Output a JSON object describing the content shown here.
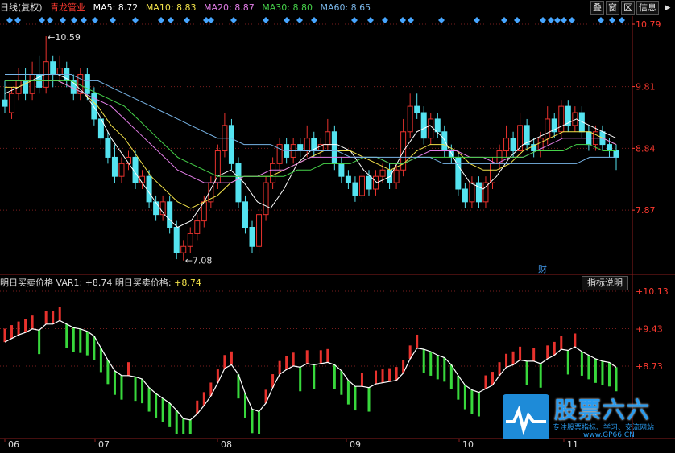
{
  "header": {
    "chart_label": "日线(复权)",
    "stock_name": "青龙管业",
    "ma5": "MA5: 8.72",
    "ma10": "MA10: 8.83",
    "ma20": "MA20: 8.87",
    "ma30": "MA30: 8.80",
    "ma60": "MA60: 8.65",
    "btn_stack": "叠",
    "btn_window": "窗",
    "btn_area": "区",
    "btn_info": "信息",
    "btn_menu": "▶"
  },
  "colors": {
    "up": "#e8322d",
    "down": "#54e3f0",
    "ma5": "#ffffff",
    "ma10": "#f2e24a",
    "ma20": "#e37ee8",
    "ma30": "#46d24a",
    "ma60": "#78b4e6",
    "grid": "#7a1e1e",
    "marker": "#47a6ff",
    "sub_up": "#e8322d",
    "sub_down": "#38d83c"
  },
  "sub": {
    "label1": "明日买卖价格",
    "var1": "VAR1: +8.74",
    "label2": "明日买卖价格:",
    "val2": "+8.74",
    "btn": "指标说明"
  },
  "annotations": {
    "high": "←10.59",
    "low": "←7.08",
    "fin": "财"
  },
  "logo": {
    "title": "股票六六",
    "subtitle": "专注股票指标、学习、交流网站",
    "url": "www.GP66.CN"
  },
  "chart_data": {
    "type": "candlestick",
    "price_axis": {
      "ticks": [
        "10.79",
        "9.81",
        "8.84",
        "7.87"
      ],
      "range": [
        7.0,
        10.79
      ]
    },
    "sub_axis": {
      "ticks": [
        "+10.13",
        "+9.43",
        "+8.73"
      ],
      "range": [
        7.45,
        10.13
      ]
    },
    "x_labels": [
      "06",
      "07",
      "08",
      "09",
      "10",
      "11"
    ],
    "candles": [
      [
        9.6,
        9.5,
        9.9,
        9.4
      ],
      [
        9.4,
        9.7,
        9.8,
        9.3
      ],
      [
        9.7,
        9.9,
        10.1,
        9.6
      ],
      [
        9.9,
        9.7,
        10.1,
        9.6
      ],
      [
        9.7,
        10.0,
        10.2,
        9.6
      ],
      [
        10.0,
        9.8,
        10.3,
        9.7
      ],
      [
        9.8,
        10.2,
        10.6,
        9.7
      ],
      [
        10.2,
        10.0,
        10.3,
        9.8
      ],
      [
        10.0,
        10.1,
        10.3,
        9.9
      ],
      [
        10.1,
        9.9,
        10.2,
        9.8
      ],
      [
        9.9,
        9.7,
        10.0,
        9.6
      ],
      [
        9.7,
        10.0,
        10.1,
        9.6
      ],
      [
        10.0,
        9.7,
        10.1,
        9.6
      ],
      [
        9.7,
        9.3,
        9.8,
        9.2
      ],
      [
        9.3,
        9.0,
        9.4,
        8.9
      ],
      [
        9.0,
        8.7,
        9.1,
        8.6
      ],
      [
        8.7,
        8.4,
        8.9,
        8.3
      ],
      [
        8.4,
        8.6,
        8.7,
        8.3
      ],
      [
        8.6,
        8.7,
        8.8,
        8.5
      ],
      [
        8.7,
        8.3,
        8.8,
        8.2
      ],
      [
        8.3,
        8.4,
        8.5,
        8.2
      ],
      [
        8.4,
        8.0,
        8.5,
        7.9
      ],
      [
        8.0,
        7.8,
        8.1,
        7.7
      ],
      [
        7.8,
        8.0,
        8.1,
        7.7
      ],
      [
        8.0,
        7.6,
        8.1,
        7.5
      ],
      [
        7.6,
        7.2,
        7.7,
        7.1
      ],
      [
        7.2,
        7.3,
        7.4,
        7.08
      ],
      [
        7.3,
        7.5,
        7.6,
        7.2
      ],
      [
        7.5,
        7.7,
        7.8,
        7.4
      ],
      [
        7.7,
        8.0,
        8.1,
        7.6
      ],
      [
        8.0,
        8.3,
        8.4,
        7.9
      ],
      [
        8.3,
        8.8,
        8.9,
        8.2
      ],
      [
        8.8,
        9.2,
        9.4,
        8.7
      ],
      [
        9.2,
        8.6,
        9.3,
        8.5
      ],
      [
        8.6,
        8.0,
        8.7,
        7.9
      ],
      [
        8.0,
        7.6,
        8.1,
        7.5
      ],
      [
        7.6,
        7.3,
        7.7,
        7.2
      ],
      [
        7.3,
        7.8,
        7.9,
        7.2
      ],
      [
        7.8,
        8.3,
        8.4,
        7.7
      ],
      [
        8.3,
        8.6,
        8.7,
        8.2
      ],
      [
        8.6,
        8.9,
        9.0,
        8.5
      ],
      [
        8.9,
        8.7,
        9.0,
        8.6
      ],
      [
        8.7,
        8.9,
        9.0,
        8.6
      ],
      [
        8.9,
        8.8,
        9.0,
        8.7
      ],
      [
        8.8,
        9.0,
        9.2,
        8.7
      ],
      [
        9.0,
        8.8,
        9.1,
        8.7
      ],
      [
        8.8,
        8.9,
        9.0,
        8.7
      ],
      [
        8.9,
        9.1,
        9.3,
        8.8
      ],
      [
        9.1,
        8.6,
        9.2,
        8.5
      ],
      [
        8.6,
        8.4,
        8.7,
        8.3
      ],
      [
        8.4,
        8.3,
        8.5,
        8.2
      ],
      [
        8.3,
        8.1,
        8.4,
        8.0
      ],
      [
        8.1,
        8.4,
        8.5,
        8.0
      ],
      [
        8.4,
        8.2,
        8.5,
        8.1
      ],
      [
        8.2,
        8.4,
        8.5,
        8.1
      ],
      [
        8.4,
        8.5,
        8.6,
        8.3
      ],
      [
        8.5,
        8.3,
        8.6,
        8.2
      ],
      [
        8.3,
        8.5,
        8.6,
        8.2
      ],
      [
        8.5,
        9.1,
        9.3,
        8.4
      ],
      [
        9.1,
        9.5,
        9.7,
        9.0
      ],
      [
        9.5,
        9.4,
        9.7,
        9.3
      ],
      [
        9.4,
        9.0,
        9.5,
        8.9
      ],
      [
        9.0,
        9.3,
        9.4,
        8.9
      ],
      [
        9.3,
        9.1,
        9.4,
        9.0
      ],
      [
        9.1,
        8.8,
        9.2,
        8.7
      ],
      [
        8.8,
        8.7,
        8.9,
        8.6
      ],
      [
        8.7,
        8.2,
        8.8,
        8.1
      ],
      [
        8.2,
        8.0,
        8.3,
        7.9
      ],
      [
        8.0,
        8.3,
        8.4,
        7.9
      ],
      [
        8.3,
        8.0,
        8.4,
        7.9
      ],
      [
        8.0,
        8.3,
        8.4,
        7.9
      ],
      [
        8.3,
        8.6,
        8.7,
        8.2
      ],
      [
        8.6,
        8.8,
        8.9,
        8.5
      ],
      [
        8.8,
        9.0,
        9.2,
        8.7
      ],
      [
        9.0,
        8.8,
        9.1,
        8.7
      ],
      [
        8.8,
        9.2,
        9.4,
        8.7
      ],
      [
        9.2,
        8.9,
        9.3,
        8.8
      ],
      [
        8.9,
        8.8,
        9.0,
        8.7
      ],
      [
        8.8,
        9.0,
        9.1,
        8.7
      ],
      [
        9.0,
        9.3,
        9.5,
        8.9
      ],
      [
        9.3,
        9.1,
        9.4,
        9.0
      ],
      [
        9.1,
        9.5,
        9.6,
        9.0
      ],
      [
        9.5,
        9.2,
        9.6,
        9.1
      ],
      [
        9.2,
        9.4,
        9.5,
        9.1
      ],
      [
        9.4,
        9.1,
        9.5,
        9.0
      ],
      [
        9.1,
        8.9,
        9.2,
        8.8
      ],
      [
        8.9,
        9.1,
        9.2,
        8.8
      ],
      [
        9.1,
        8.9,
        9.2,
        8.8
      ],
      [
        8.9,
        8.8,
        9.0,
        8.7
      ],
      [
        8.8,
        8.7,
        8.9,
        8.5
      ]
    ],
    "ma_lines": {
      "ma5": [
        9.7,
        9.8,
        9.9,
        10.0,
        10.0,
        9.9,
        9.7,
        9.4,
        9.0,
        8.7,
        8.4,
        8.1,
        7.8,
        7.6,
        7.7,
        8.0,
        8.4,
        8.5,
        8.3,
        8.0,
        7.9,
        8.2,
        8.6,
        8.8,
        8.9,
        8.9,
        8.8,
        8.5,
        8.3,
        8.4,
        8.8,
        9.1,
        9.2,
        9.0,
        8.6,
        8.3,
        8.2,
        8.4,
        8.7,
        8.9,
        9.0,
        9.1,
        9.2,
        9.3,
        9.2,
        9.1,
        9.0
      ],
      "ma10": [
        9.8,
        9.8,
        9.9,
        9.9,
        9.9,
        9.8,
        9.7,
        9.5,
        9.2,
        9.0,
        8.7,
        8.4,
        8.2,
        8.0,
        7.9,
        8.0,
        8.1,
        8.3,
        8.4,
        8.4,
        8.4,
        8.5,
        8.6,
        8.7,
        8.8,
        8.8,
        8.8,
        8.7,
        8.6,
        8.5,
        8.6,
        8.8,
        8.9,
        8.9,
        8.8,
        8.6,
        8.5,
        8.5,
        8.6,
        8.8,
        8.9,
        9.0,
        9.1,
        9.1,
        9.1,
        9.0,
        8.9
      ],
      "ma20": [
        9.9,
        9.9,
        9.9,
        9.9,
        9.9,
        9.8,
        9.7,
        9.6,
        9.5,
        9.3,
        9.1,
        8.9,
        8.7,
        8.5,
        8.4,
        8.3,
        8.3,
        8.3,
        8.4,
        8.4,
        8.5,
        8.5,
        8.6,
        8.7,
        8.7,
        8.7,
        8.7,
        8.7,
        8.7,
        8.6,
        8.6,
        8.7,
        8.8,
        8.8,
        8.8,
        8.7,
        8.7,
        8.6,
        8.7,
        8.7,
        8.8,
        8.9,
        9.0,
        9.0,
        9.0,
        9.0,
        8.9
      ],
      "ma30": [
        9.9,
        9.9,
        9.9,
        9.9,
        9.9,
        9.9,
        9.8,
        9.7,
        9.6,
        9.5,
        9.3,
        9.1,
        8.9,
        8.7,
        8.6,
        8.5,
        8.4,
        8.4,
        8.4,
        8.4,
        8.4,
        8.4,
        8.5,
        8.5,
        8.6,
        8.6,
        8.6,
        8.7,
        8.7,
        8.6,
        8.6,
        8.7,
        8.7,
        8.7,
        8.7,
        8.7,
        8.7,
        8.7,
        8.7,
        8.7,
        8.8,
        8.8,
        8.8,
        8.9,
        8.9,
        8.8,
        8.8
      ],
      "ma60": [
        10.0,
        10.0,
        10.0,
        10.0,
        10.0,
        10.0,
        9.9,
        9.9,
        9.8,
        9.7,
        9.6,
        9.5,
        9.4,
        9.3,
        9.2,
        9.1,
        9.0,
        9.0,
        8.9,
        8.9,
        8.9,
        8.8,
        8.8,
        8.8,
        8.8,
        8.8,
        8.7,
        8.7,
        8.7,
        8.7,
        8.7,
        8.7,
        8.7,
        8.6,
        8.6,
        8.6,
        8.6,
        8.6,
        8.6,
        8.6,
        8.6,
        8.6,
        8.6,
        8.6,
        8.7,
        8.7,
        8.7
      ]
    }
  }
}
